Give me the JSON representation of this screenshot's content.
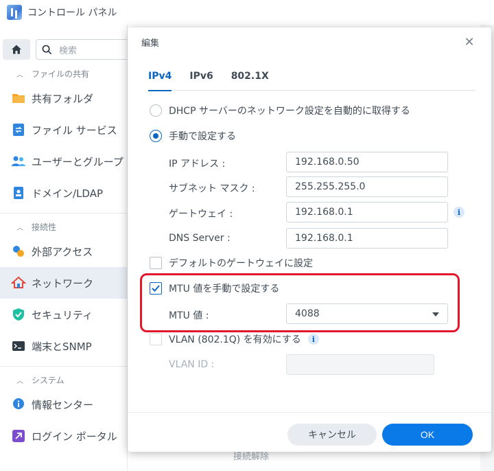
{
  "app": {
    "title": "コントロール パネル",
    "search_placeholder": "検索"
  },
  "sidebar": {
    "sections": [
      {
        "title": "ファイルの共有",
        "items": [
          {
            "label": "共有フォルダ",
            "icon": "folder-icon"
          },
          {
            "label": "ファイル サービス",
            "icon": "file-services-icon"
          },
          {
            "label": "ユーザーとグループ",
            "icon": "users-icon"
          },
          {
            "label": "ドメイン/LDAP",
            "icon": "domain-icon"
          }
        ]
      },
      {
        "title": "接続性",
        "items": [
          {
            "label": "外部アクセス",
            "icon": "external-access-icon"
          },
          {
            "label": "ネットワーク",
            "icon": "network-icon",
            "active": true
          },
          {
            "label": "セキュリティ",
            "icon": "shield-icon"
          },
          {
            "label": "端末とSNMP",
            "icon": "terminal-icon"
          }
        ]
      },
      {
        "title": "システム",
        "items": [
          {
            "label": "情報センター",
            "icon": "info-center-icon"
          },
          {
            "label": "ログイン ポータル",
            "icon": "login-portal-icon"
          }
        ]
      }
    ]
  },
  "background": {
    "obscured_text": "接続解除"
  },
  "dialog": {
    "title": "編集",
    "tabs": [
      "IPv4",
      "IPv6",
      "802.1X"
    ],
    "active_tab": "IPv4",
    "dhcp_option": "DHCP サーバーのネットワーク設定を自動的に取得する",
    "manual_option": "手動で設定する",
    "fields": {
      "ip_label": "IP アドレス :",
      "ip_value": "192.168.0.50",
      "subnet_label": "サブネット マスク :",
      "subnet_value": "255.255.255.0",
      "gateway_label": "ゲートウェイ :",
      "gateway_value": "192.168.0.1",
      "dns_label": "DNS Server :",
      "dns_value": "192.168.0.1"
    },
    "default_gateway_label": "デフォルトのゲートウェイに設定",
    "mtu_manual_label": "MTU 値を手動で設定する",
    "mtu_label": "MTU 値 :",
    "mtu_value": "4088",
    "vlan_label": "VLAN (802.1Q) を有効にする",
    "vlan_id_label": "VLAN ID :",
    "cancel_label": "キャンセル",
    "ok_label": "OK",
    "info_glyph": "i",
    "close_glyph": "✕"
  },
  "colors": {
    "accent": "#0a66c2",
    "highlight_border": "#e3162b",
    "ok_button": "#0a7ae8"
  }
}
